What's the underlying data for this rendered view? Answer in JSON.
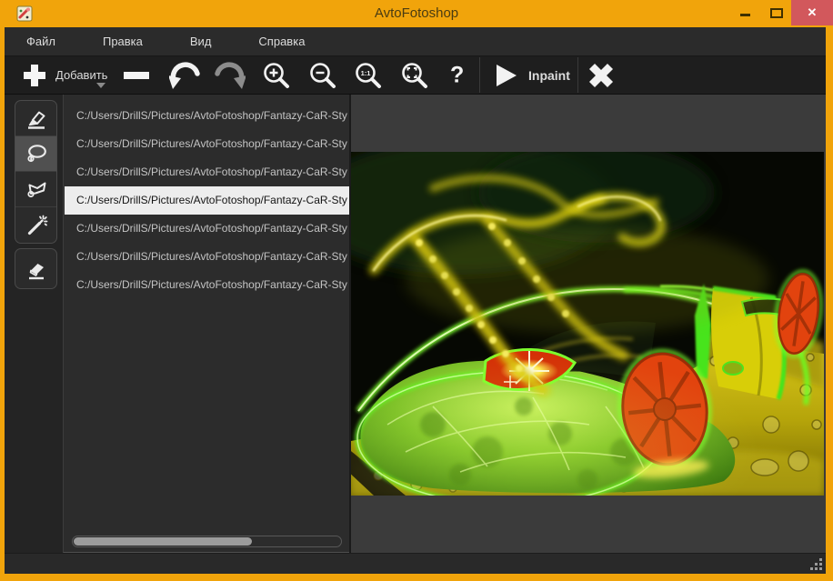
{
  "window": {
    "title": "AvtoFotoshop",
    "controls": {
      "minimize": "–",
      "maximize": "□",
      "close": "✕"
    }
  },
  "menu": {
    "items": [
      "Файл",
      "Правка",
      "Вид",
      "Справка"
    ]
  },
  "toolbar": {
    "add_label": "Добавить",
    "inpaint_label": "Inpaint",
    "one_to_one_label": "1:1",
    "help_label": "?"
  },
  "sidebar": {
    "selected_tool": "lasso",
    "tools": [
      {
        "id": "marker",
        "icon": "marker-pen-icon"
      },
      {
        "id": "lasso",
        "icon": "lasso-icon"
      },
      {
        "id": "polygon-lasso",
        "icon": "polygon-lasso-icon"
      },
      {
        "id": "magic-wand",
        "icon": "magic-wand-icon"
      },
      {
        "id": "eraser",
        "icon": "eraser-icon"
      }
    ]
  },
  "file_list": {
    "selected_index": 3,
    "items": [
      "C:/Users/DrillS/Pictures/AvtoFotoshop/Fantazy-CaR-Sty",
      "C:/Users/DrillS/Pictures/AvtoFotoshop/Fantazy-CaR-Sty",
      "C:/Users/DrillS/Pictures/AvtoFotoshop/Fantazy-CaR-Sty",
      "C:/Users/DrillS/Pictures/AvtoFotoshop/Fantazy-CaR-Sty",
      "C:/Users/DrillS/Pictures/AvtoFotoshop/Fantazy-CaR-Sty",
      "C:/Users/DrillS/Pictures/AvtoFotoshop/Fantazy-CaR-Sty",
      "C:/Users/DrillS/Pictures/AvtoFotoshop/Fantazy-CaR-Sty"
    ],
    "scrollbar_thumb_fraction": 0.66
  },
  "icons": {
    "add-icon": "+",
    "remove-icon": "−",
    "undo-icon": "curved-arrow-left",
    "redo-icon": "curved-arrow-right",
    "zoom-in-icon": "magnifier-plus",
    "zoom-out-icon": "magnifier-minus",
    "zoom-actual-icon": "magnifier-1:1",
    "zoom-fit-icon": "magnifier-fit",
    "help-icon": "?",
    "play-icon": "▶",
    "clear-icon": "✕",
    "resize-grip-icon": "corner-dots"
  },
  "colors": {
    "titlebar": "#F1A40B",
    "close_button": "#D2585C",
    "menubar_bg": "#2B2B2B",
    "toolbar_bg": "#1E1E1E",
    "sidebar_bg": "#242424",
    "list_bg": "#2C2C2C",
    "list_text": "#C4C4C4",
    "selected_row_bg": "#EDEDED",
    "selected_row_text": "#141414",
    "canvas_bg": "#3B3B3B",
    "statusbar_bg": "#292929",
    "tool_border": "#4A4A4A",
    "neon_green": "#7DFF2E",
    "wheel_red": "#E2430E"
  }
}
